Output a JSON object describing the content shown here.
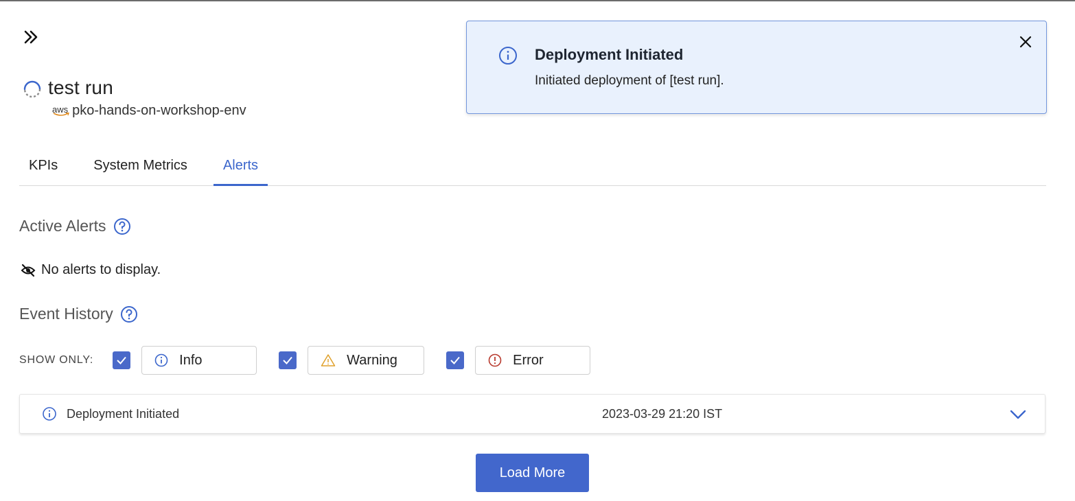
{
  "run": {
    "title": "test run",
    "provider_badge": "aws",
    "environment": "pko-hands-on-workshop-env"
  },
  "tabs": [
    {
      "label": "KPIs",
      "active": false
    },
    {
      "label": "System Metrics",
      "active": false
    },
    {
      "label": "Alerts",
      "active": true
    }
  ],
  "active_alerts": {
    "title": "Active Alerts",
    "empty_message": "No alerts to display."
  },
  "event_history": {
    "title": "Event History",
    "show_only_label": "SHOW ONLY:",
    "filters": [
      {
        "label": "Info",
        "checked": true,
        "icon": "info-icon",
        "color": "#3b66cc"
      },
      {
        "label": "Warning",
        "checked": true,
        "icon": "warning-icon",
        "color": "#e0a12b"
      },
      {
        "label": "Error",
        "checked": true,
        "icon": "error-icon",
        "color": "#b83a2e"
      }
    ],
    "events": [
      {
        "title": "Deployment Initiated",
        "timestamp": "2023-03-29 21:20 IST",
        "icon": "info-icon"
      }
    ],
    "load_more_label": "Load More"
  },
  "toast": {
    "title": "Deployment Initiated",
    "message": "Initiated deployment of [test run]."
  },
  "colors": {
    "accent": "#3b66cc",
    "button": "#4267cc",
    "toast_bg": "#e9f1fd",
    "toast_border": "#7296dc"
  }
}
